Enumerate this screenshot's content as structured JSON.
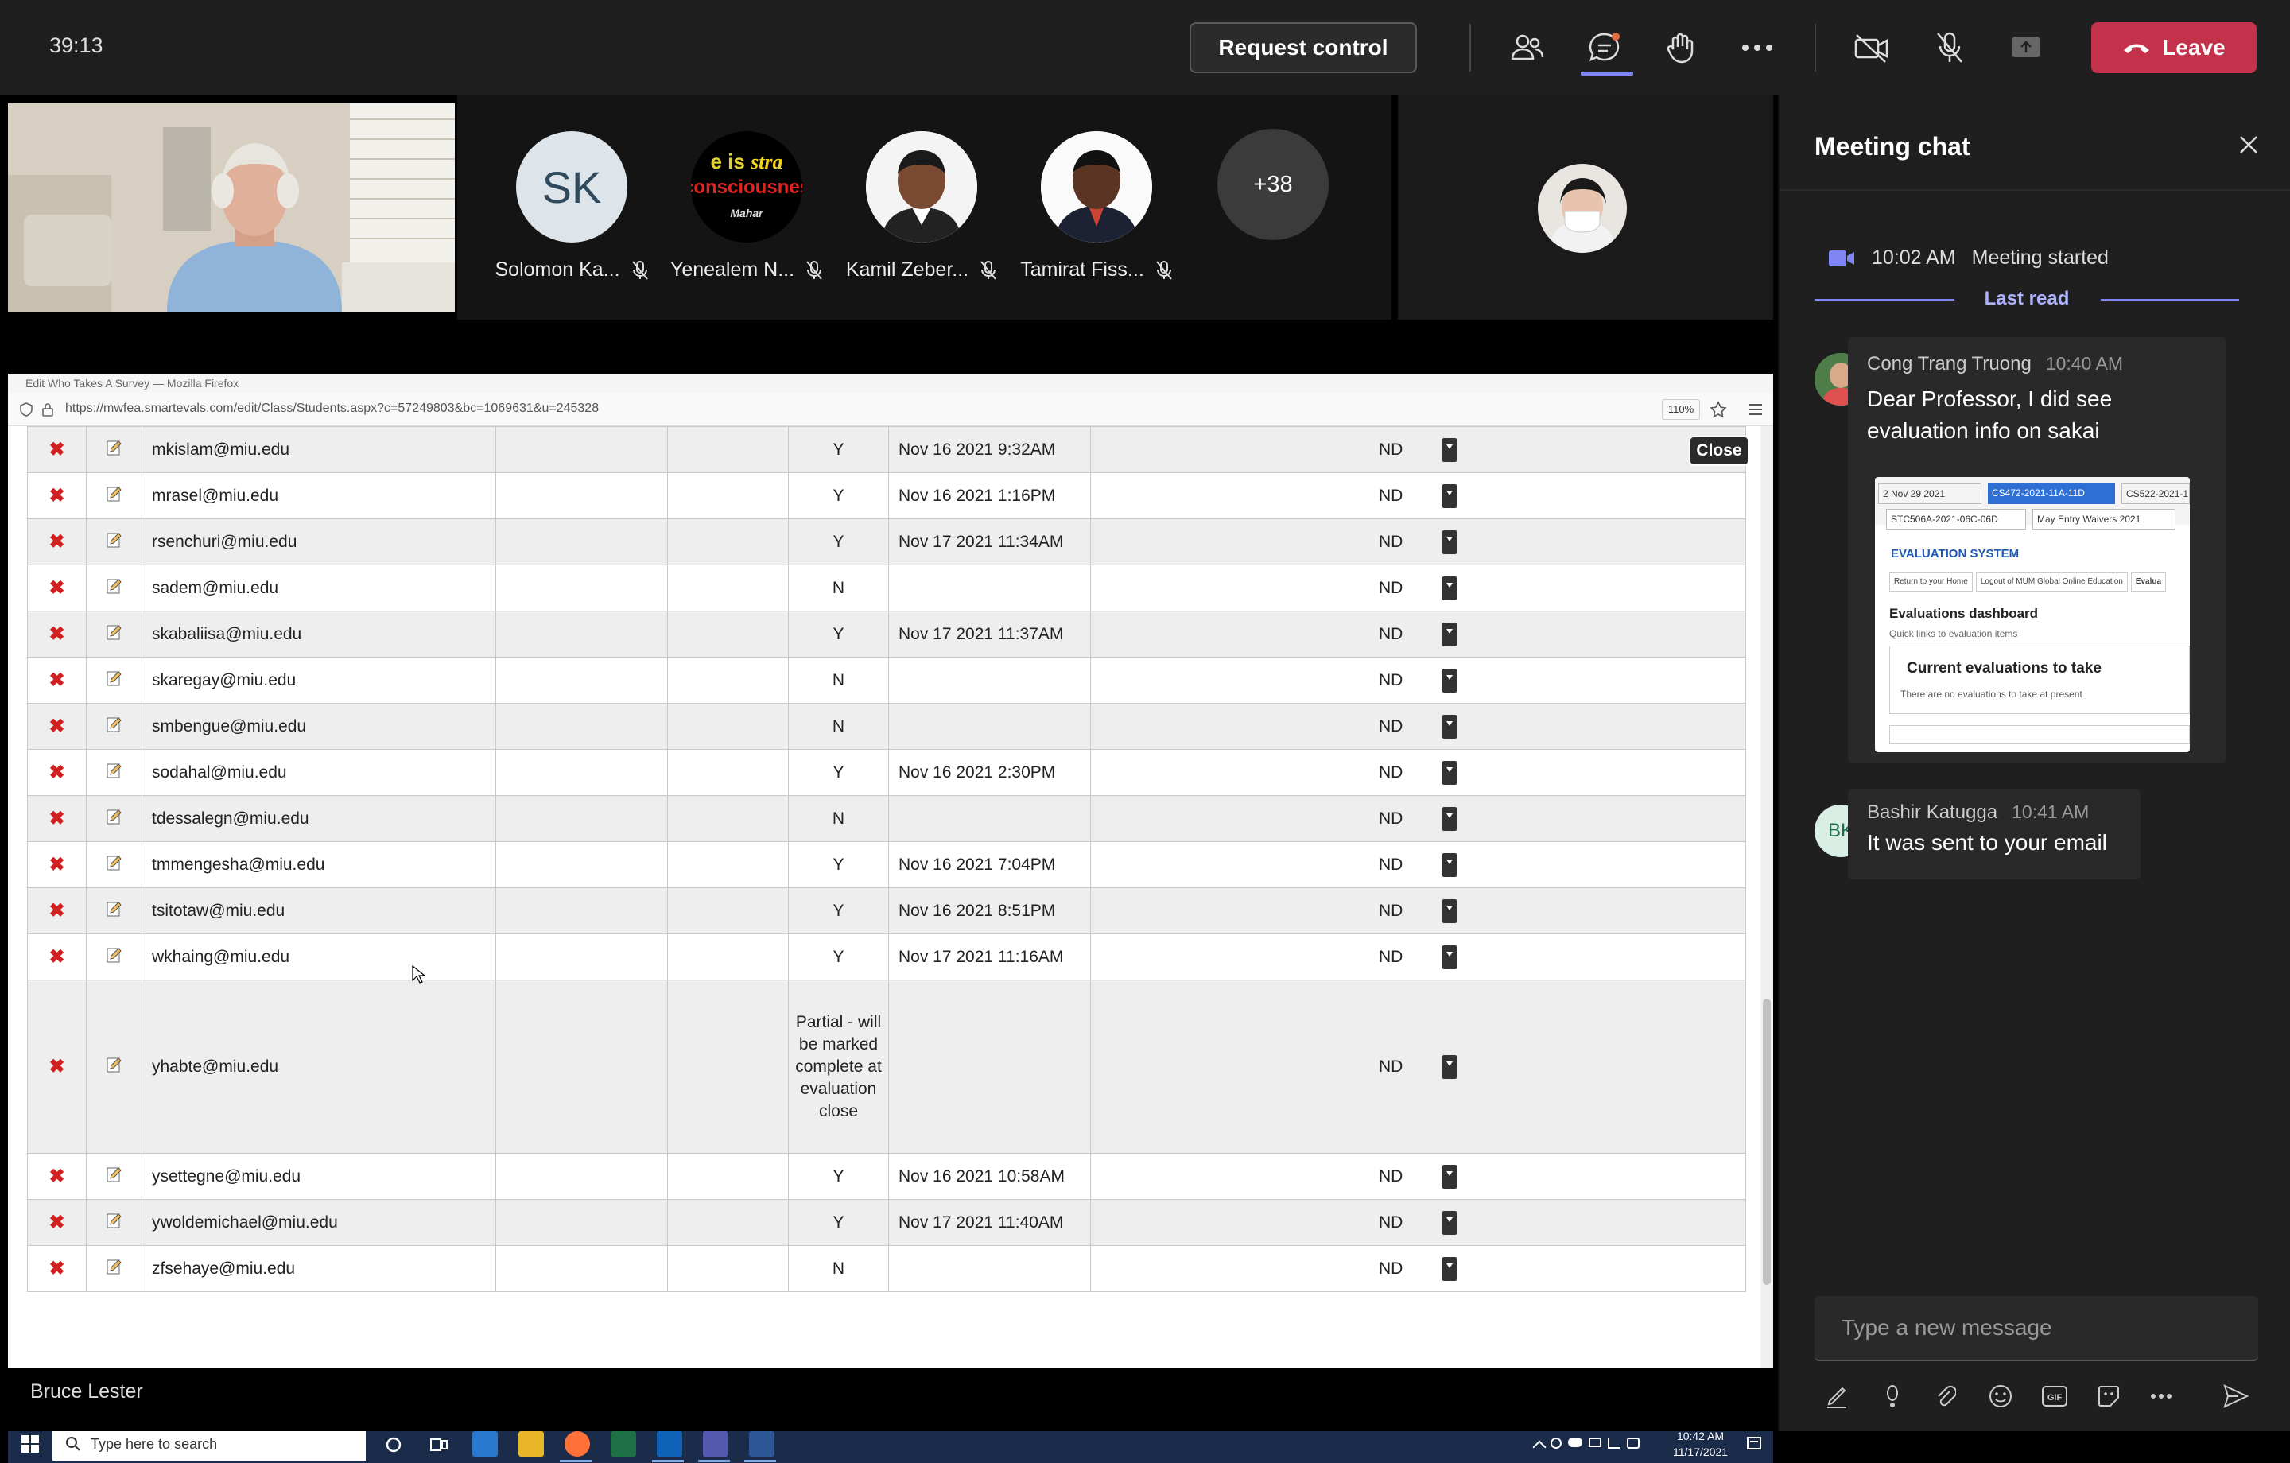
{
  "meeting": {
    "timer": "39:13",
    "request_control": "Request control",
    "leave": "Leave",
    "presenter_name": "Bruce Lester",
    "more_count": "+38"
  },
  "participants": [
    {
      "initials": "SK",
      "name": "Solomon Ka..."
    },
    {
      "initials": "",
      "name": "Yenealem N...",
      "avatar_text": [
        "e is",
        "stra",
        "consciousnes",
        "Mahar"
      ]
    },
    {
      "initials": "",
      "name": "Kamil Zeber..."
    },
    {
      "initials": "",
      "name": "Tamirat Fiss..."
    }
  ],
  "browser": {
    "title": "Edit Who Takes A Survey — Mozilla Firefox",
    "url": "https://mwfea.smartevals.com/edit/Class/Students.aspx?c=57249803&bc=1069631&u=245328",
    "zoom": "110%",
    "close_label": "Close"
  },
  "table": {
    "rows": [
      {
        "email": "mkislam@miu.edu",
        "responded": "Y",
        "date": "Nov 16 2021 9:32AM",
        "status": "ND"
      },
      {
        "email": "mrasel@miu.edu",
        "responded": "Y",
        "date": "Nov 16 2021 1:16PM",
        "status": "ND"
      },
      {
        "email": "rsenchuri@miu.edu",
        "responded": "Y",
        "date": "Nov 17 2021 11:34AM",
        "status": "ND"
      },
      {
        "email": "sadem@miu.edu",
        "responded": "N",
        "date": "",
        "status": "ND"
      },
      {
        "email": "skabaliisa@miu.edu",
        "responded": "Y",
        "date": "Nov 17 2021 11:37AM",
        "status": "ND"
      },
      {
        "email": "skaregay@miu.edu",
        "responded": "N",
        "date": "",
        "status": "ND"
      },
      {
        "email": "smbengue@miu.edu",
        "responded": "N",
        "date": "",
        "status": "ND"
      },
      {
        "email": "sodahal@miu.edu",
        "responded": "Y",
        "date": "Nov 16 2021 2:30PM",
        "status": "ND"
      },
      {
        "email": "tdessalegn@miu.edu",
        "responded": "N",
        "date": "",
        "status": "ND"
      },
      {
        "email": "tmmengesha@miu.edu",
        "responded": "Y",
        "date": "Nov 16 2021 7:04PM",
        "status": "ND"
      },
      {
        "email": "tsitotaw@miu.edu",
        "responded": "Y",
        "date": "Nov 16 2021 8:51PM",
        "status": "ND"
      },
      {
        "email": "wkhaing@miu.edu",
        "responded": "Y",
        "date": "Nov 17 2021 11:16AM",
        "status": "ND"
      },
      {
        "email": "yhabte@miu.edu",
        "responded": "Partial - will be marked complete at evaluation close",
        "date": "",
        "status": "ND"
      },
      {
        "email": "ysettegne@miu.edu",
        "responded": "Y",
        "date": "Nov 16 2021 10:58AM",
        "status": "ND"
      },
      {
        "email": "ywoldemichael@miu.edu",
        "responded": "Y",
        "date": "Nov 17 2021 11:40AM",
        "status": "ND"
      },
      {
        "email": "zfsehaye@miu.edu",
        "responded": "N",
        "date": "",
        "status": "ND"
      }
    ]
  },
  "taskbar": {
    "search_placeholder": "Type here to search",
    "time": "10:42 AM",
    "date": "11/17/2021"
  },
  "chat": {
    "title": "Meeting chat",
    "meeting_started_time": "10:02 AM",
    "meeting_started_label": "Meeting started",
    "last_read": "Last read",
    "messages": [
      {
        "author": "Cong Trang Truong",
        "time": "10:40 AM",
        "text": "Dear Professor, I did see evaluation info on sakai",
        "initials": ""
      },
      {
        "author": "Bashir Katugga",
        "time": "10:41 AM",
        "text": "It was sent to your email",
        "initials": "BK"
      }
    ],
    "compose_placeholder": "Type a new message",
    "pasted_image": {
      "dropdowns": [
        "2 Nov 29 2021",
        "CS472-2021-11A-11D",
        "CS522-2021-1",
        "STC506A-2021-06C-06D",
        "May Entry Waivers 2021"
      ],
      "system_title": "EVALUATION SYSTEM",
      "tabs": [
        "Return to your Home",
        "Logout of MUM Global Online Education",
        "Evalua"
      ],
      "dashboard_title": "Evaluations dashboard",
      "dashboard_sub": "Quick links to evaluation items",
      "current_title": "Current evaluations to take",
      "current_sub": "There are no evaluations to take at present"
    }
  },
  "colors": {
    "leave": "#c4314b",
    "accent": "#7f85f5",
    "muted_mic": "#dddddd"
  }
}
